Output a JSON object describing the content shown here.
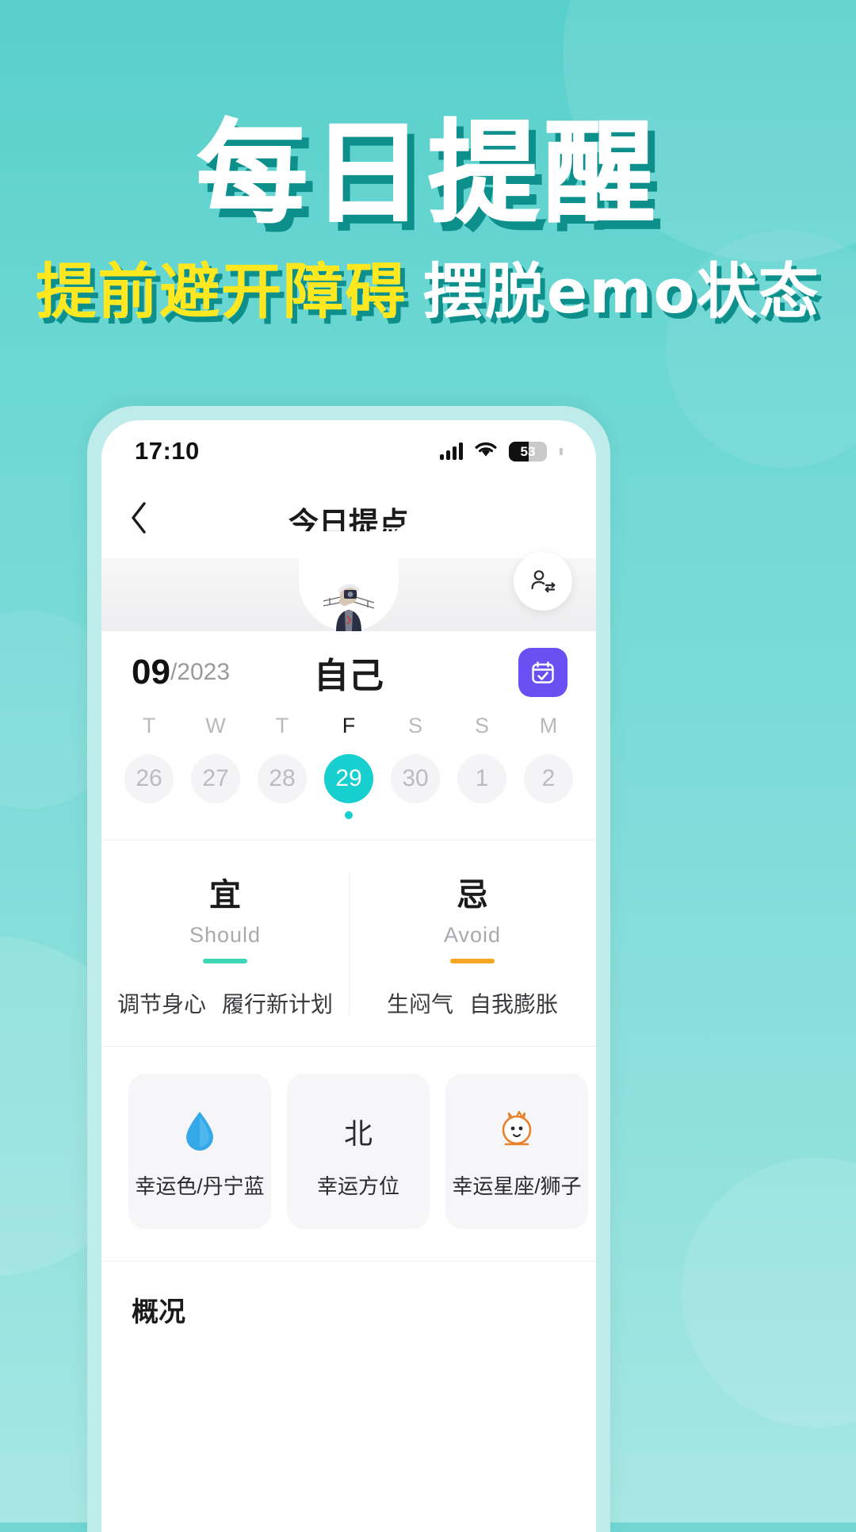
{
  "promo": {
    "headline": "每日提醒",
    "subline_yellow": "提前避开障碍",
    "subline_white": "摆脱emo状态"
  },
  "colors": {
    "bg_top": "#58cfcb",
    "bg_bottom": "#a7e7e4",
    "headline_shadow": "#0d8f8c",
    "yellow": "#ffe81f",
    "accent_teal": "#17cfcf",
    "should_bar": "#3fd6b8",
    "avoid_bar": "#f5a623",
    "calendar_button": "#6a4ff2"
  },
  "phone": {
    "status": {
      "time": "17:10",
      "signal_icon": "signal-bars-icon",
      "wifi_icon": "wifi-icon",
      "battery_icon": "battery-icon",
      "battery_level": "53"
    },
    "nav": {
      "back_icon": "chevron-left-icon",
      "title": "今日提点"
    },
    "profile": {
      "avatar_icon": "avatar-photographer-icon",
      "switch_icon": "switch-user-icon",
      "name": "自己"
    },
    "date": {
      "month": "09",
      "year_suffix": "/2023",
      "calendar_icon": "calendar-check-icon"
    },
    "week": [
      {
        "dow": "T",
        "num": "26",
        "selected": false,
        "dot": false
      },
      {
        "dow": "W",
        "num": "27",
        "selected": false,
        "dot": false
      },
      {
        "dow": "T",
        "num": "28",
        "selected": false,
        "dot": false
      },
      {
        "dow": "F",
        "num": "29",
        "selected": true,
        "dot": true
      },
      {
        "dow": "S",
        "num": "30",
        "selected": false,
        "dot": false
      },
      {
        "dow": "S",
        "num": "1",
        "selected": false,
        "dot": false
      },
      {
        "dow": "M",
        "num": "2",
        "selected": false,
        "dot": false
      }
    ],
    "should": {
      "cn": "宜",
      "en": "Should",
      "items": [
        "调节身心",
        "履行新计划"
      ]
    },
    "avoid": {
      "cn": "忌",
      "en": "Avoid",
      "items": [
        "生闷气",
        "自我膨胀"
      ]
    },
    "lucky_cards": [
      {
        "icon": "water-drop-icon",
        "glyph": "💧",
        "label": "幸运色/丹宁蓝"
      },
      {
        "icon": "direction-north-icon",
        "glyph": "北",
        "label": "幸运方位"
      },
      {
        "icon": "zodiac-leo-icon",
        "glyph": "🦁",
        "label": "幸运星座/狮子"
      },
      {
        "icon": "partial-card-icon",
        "glyph": "",
        "label": ""
      }
    ],
    "overview": {
      "title": "概况"
    }
  }
}
